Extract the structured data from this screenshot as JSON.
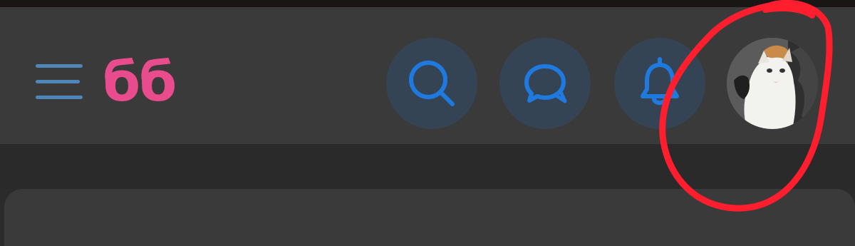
{
  "header": {
    "menu_icon": "hamburger-menu-icon",
    "brand_text": "бб",
    "actions": [
      {
        "name": "search",
        "icon": "search-icon"
      },
      {
        "name": "messages",
        "icon": "chat-bubble-icon"
      },
      {
        "name": "notifications",
        "icon": "bell-icon"
      }
    ],
    "avatar_icon": "user-avatar-cat"
  },
  "colors": {
    "header_bg": "#3a3a3a",
    "page_bg": "#2b2b2b",
    "brand": "#e84c8c",
    "icon_accent": "#1f7ae0",
    "icon_button_bg": "#354455",
    "menu_bars": "#4f86b8",
    "annotation": "#ff1e2d"
  }
}
